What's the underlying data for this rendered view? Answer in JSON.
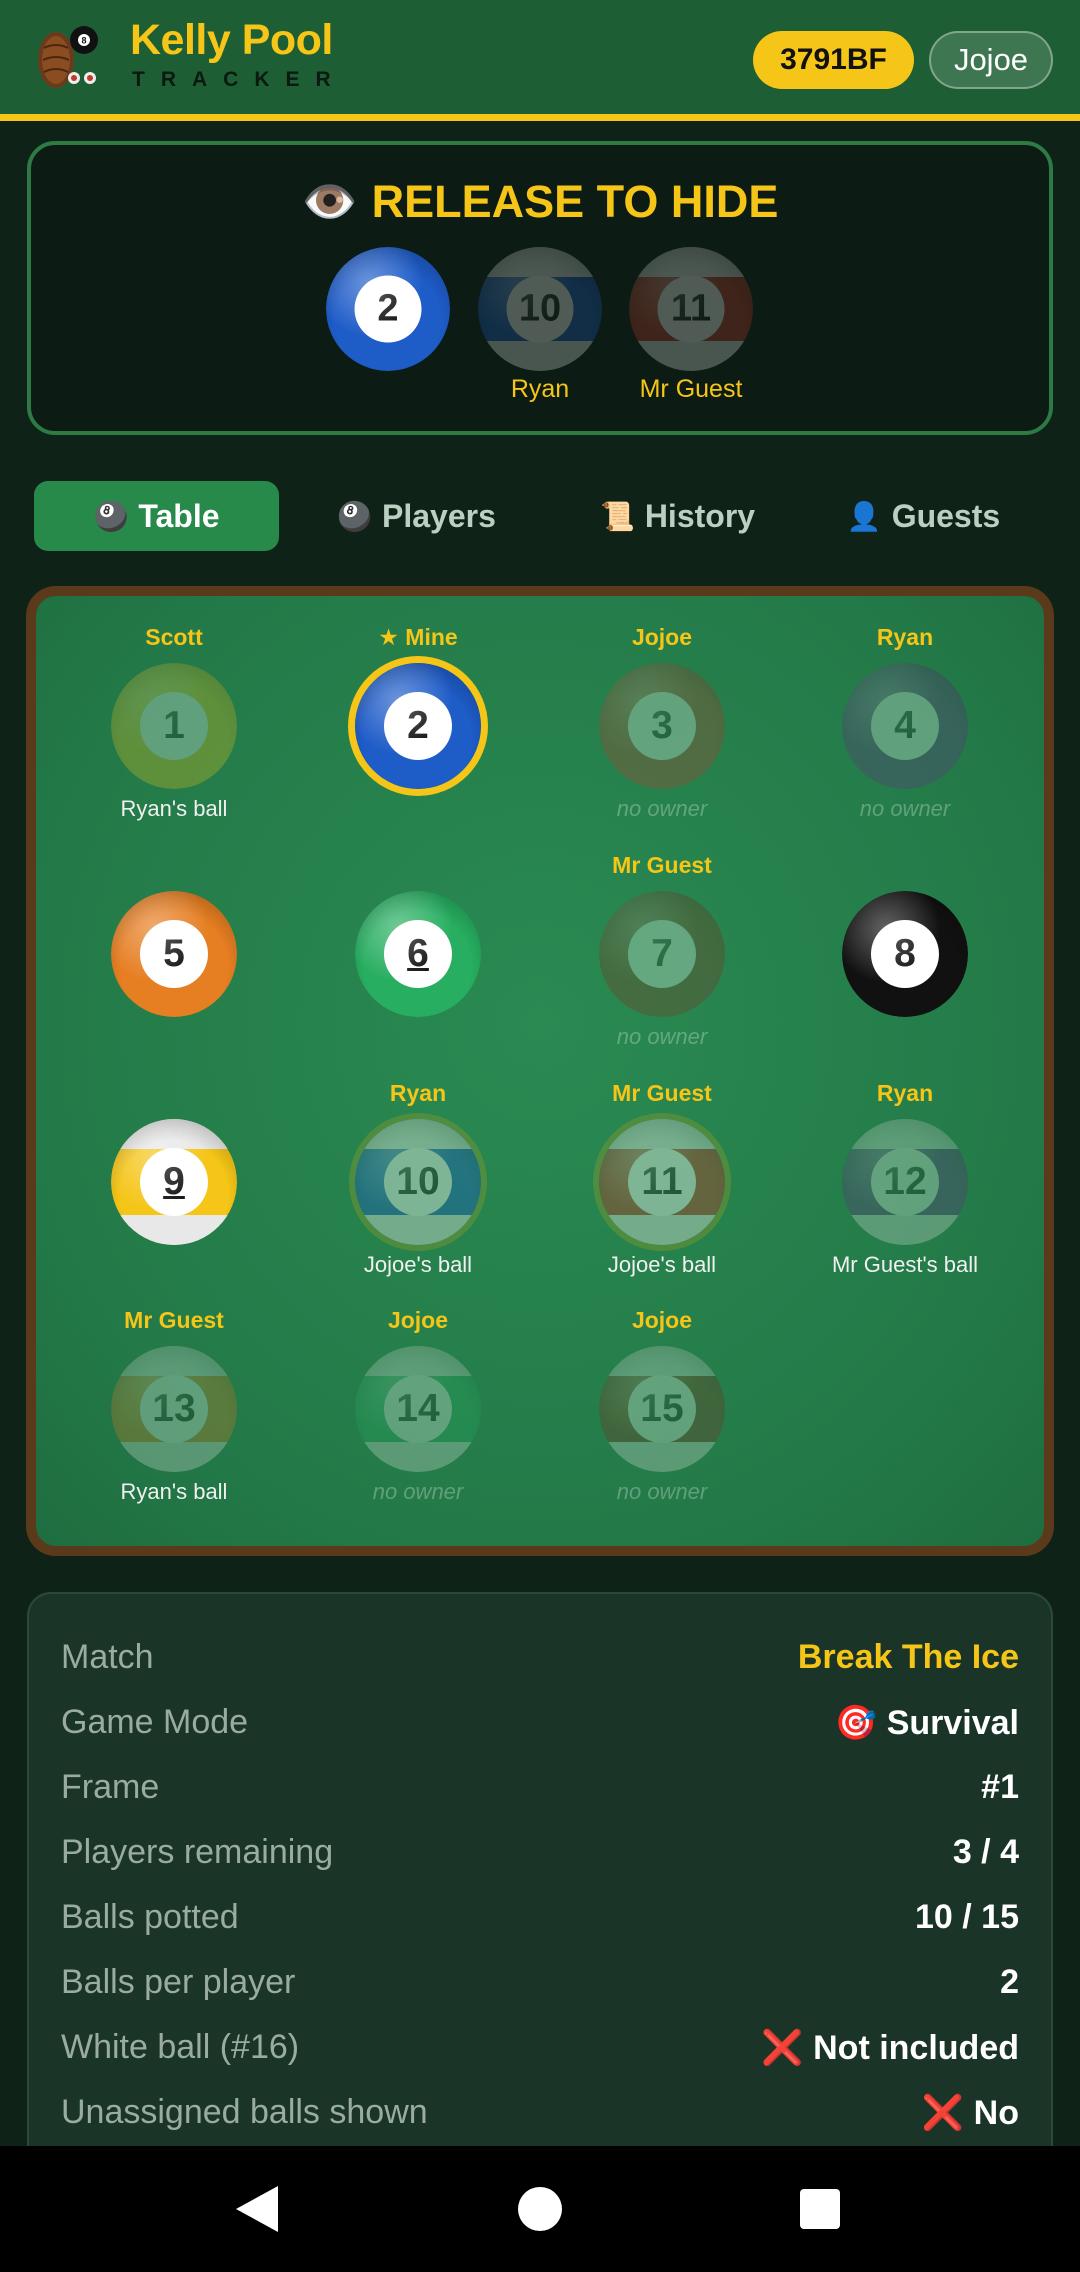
{
  "app": {
    "title": "Kelly Pool",
    "subtitle": "TRACKER",
    "room_code": "3791BF",
    "user": "Jojoe"
  },
  "reveal": {
    "title": "RELEASE TO HIDE",
    "eye_icon": "👁️",
    "balls": [
      {
        "number": "2",
        "color": "#1e5cc8",
        "stripe": false,
        "owner": ""
      },
      {
        "number": "10",
        "color": "#1e5cc8",
        "stripe": true,
        "owner": "Ryan"
      },
      {
        "number": "11",
        "color": "#c0392b",
        "stripe": true,
        "owner": "Mr Guest"
      }
    ]
  },
  "tabs": [
    {
      "icon": "🎱",
      "label": "Table",
      "active": true
    },
    {
      "icon": "🎱",
      "label": "Players",
      "active": false
    },
    {
      "icon": "📜",
      "label": "History",
      "active": false
    },
    {
      "icon": "👤",
      "label": "Guests",
      "active": false
    }
  ],
  "table": {
    "balls": [
      {
        "number": "1",
        "color": "#f5c518",
        "stripe": false,
        "top": "Scott",
        "bottom": "Ryan's ball",
        "state": "dim"
      },
      {
        "number": "2",
        "color": "#1e5cc8",
        "stripe": false,
        "top": "★ Mine",
        "bottom": "",
        "state": "mine"
      },
      {
        "number": "3",
        "color": "#c0392b",
        "stripe": false,
        "top": "Jojoe",
        "bottom": "no owner",
        "state": "dim"
      },
      {
        "number": "4",
        "color": "#6a2a8a",
        "stripe": false,
        "top": "Ryan",
        "bottom": "no owner",
        "state": "dim"
      },
      {
        "number": "5",
        "color": "#e67e22",
        "stripe": false,
        "top": "",
        "bottom": "",
        "state": "live"
      },
      {
        "number": "6",
        "color": "#27ae60",
        "stripe": false,
        "top": "",
        "bottom": "",
        "state": "live"
      },
      {
        "number": "7",
        "color": "#8b2a1a",
        "stripe": false,
        "top": "Mr Guest",
        "bottom": "no owner",
        "state": "dim"
      },
      {
        "number": "8",
        "color": "#111111",
        "stripe": false,
        "top": "",
        "bottom": "",
        "state": "live"
      },
      {
        "number": "9",
        "color": "#f5c518",
        "stripe": true,
        "top": "",
        "bottom": "",
        "state": "live"
      },
      {
        "number": "10",
        "color": "#1e5cc8",
        "stripe": true,
        "top": "Ryan",
        "bottom": "Jojoe's ball",
        "state": "claimed"
      },
      {
        "number": "11",
        "color": "#c0392b",
        "stripe": true,
        "top": "Mr Guest",
        "bottom": "Jojoe's ball",
        "state": "claimed"
      },
      {
        "number": "12",
        "color": "#6a2a8a",
        "stripe": true,
        "top": "Ryan",
        "bottom": "Mr Guest's ball",
        "state": "dim"
      },
      {
        "number": "13",
        "color": "#e67e22",
        "stripe": true,
        "top": "Mr Guest",
        "bottom": "Ryan's ball",
        "state": "dim"
      },
      {
        "number": "14",
        "color": "#27ae60",
        "stripe": true,
        "top": "Jojoe",
        "bottom": "no owner",
        "state": "dim"
      },
      {
        "number": "15",
        "color": "#8b2a1a",
        "stripe": true,
        "top": "Jojoe",
        "bottom": "no owner",
        "state": "dim"
      }
    ]
  },
  "info": {
    "rows": [
      {
        "key": "Match",
        "value": "Break The Ice",
        "accent": true
      },
      {
        "key": "Game Mode",
        "value": "🎯 Survival",
        "accent": false
      },
      {
        "key": "Frame",
        "value": "#1",
        "accent": false
      },
      {
        "key": "Players remaining",
        "value": "3 / 4",
        "accent": false
      },
      {
        "key": "Balls potted",
        "value": "10 / 15",
        "accent": false
      },
      {
        "key": "Balls per player",
        "value": "2",
        "accent": false
      },
      {
        "key": "White ball (#16)",
        "value": "❌ Not included",
        "accent": false
      },
      {
        "key": "Unassigned balls shown",
        "value": "❌ No",
        "accent": false
      }
    ]
  },
  "navbar": {
    "back_icon": "back-triangle",
    "home_icon": "home-circle",
    "recents_icon": "recents-square"
  }
}
